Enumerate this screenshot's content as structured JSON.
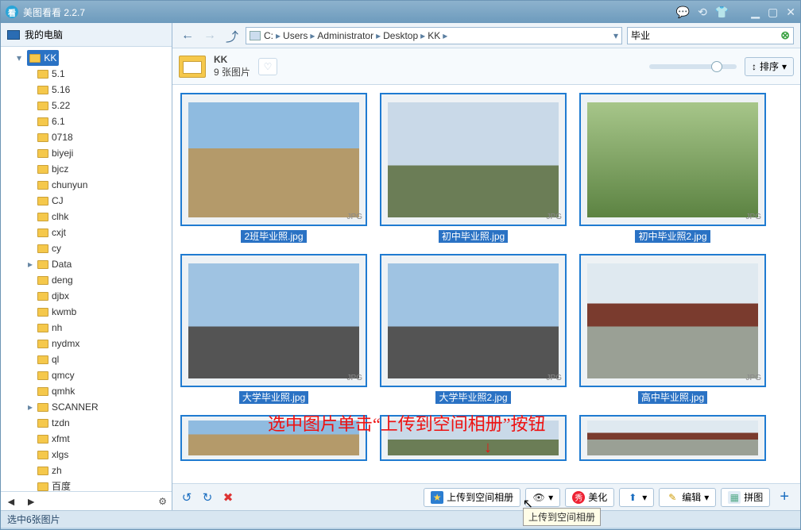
{
  "app": {
    "title": "美图看看  2.2.7",
    "icon_glyph": "看"
  },
  "titlebar_icons": {
    "chat": "聊天图标",
    "refresh": "刷新图标",
    "skin": "皮肤图标",
    "min": "最小化",
    "max": "最大化",
    "close": "关闭"
  },
  "sidebar": {
    "root_label": "我的电脑",
    "selected": "KK",
    "items": [
      "5.1",
      "5.16",
      "5.22",
      "6.1",
      "0718",
      "biyeji",
      "bjcz",
      "chunyun",
      "CJ",
      "clhk",
      "cxjt",
      "cy",
      "Data",
      "deng",
      "djbx",
      "kwmb",
      "nh",
      "nydmx",
      "ql",
      "qmcy",
      "qmhk",
      "SCANNER",
      "tzdn",
      "xfmt",
      "xlgs",
      "zh",
      "百度"
    ],
    "expandable": [
      "Data",
      "SCANNER"
    ],
    "footer_config_glyph": "⚙"
  },
  "navbar": {
    "back": "后退",
    "forward": "前进",
    "up": "上一级",
    "path": [
      "C:",
      "Users",
      "Administrator",
      "Desktop",
      "KK"
    ],
    "search_value": "毕业"
  },
  "infobar": {
    "folder_name": "KK",
    "count_text": "9 张图片",
    "fav_glyph": "♡",
    "sort_label": "排序",
    "sort_icon": "↕"
  },
  "thumbs": [
    {
      "caption": "2班毕业照.jpg",
      "ext": "JPG",
      "style": "norm"
    },
    {
      "caption": "初中毕业照.jpg",
      "ext": "JPG",
      "style": "bldg"
    },
    {
      "caption": "初中毕业照2.jpg",
      "ext": "JPG",
      "style": "grass"
    },
    {
      "caption": "大学毕业照.jpg",
      "ext": "JPG",
      "style": "grad"
    },
    {
      "caption": "大学毕业照2.jpg",
      "ext": "JPG",
      "style": "grad"
    },
    {
      "caption": "高中毕业照.jpg",
      "ext": "JPG",
      "style": "temple"
    }
  ],
  "row3": [
    {
      "style": "norm"
    },
    {
      "style": "bldg"
    },
    {
      "style": "temple"
    }
  ],
  "annotation": "选中图片单击“上传到空间相册”按钮",
  "actionbar": {
    "rotate_left": "↺",
    "rotate_right": "↻",
    "delete": "✖",
    "upload_label": "上传到空间相册",
    "weibo_tip": "微博",
    "beautify_label": "美化",
    "beautify_ic": "秀",
    "send_tip": "发送",
    "edit_label": "编辑",
    "puzzle_label": "拼图",
    "add": "+"
  },
  "tooltip": "上传到空间相册",
  "status": "选中6张图片"
}
